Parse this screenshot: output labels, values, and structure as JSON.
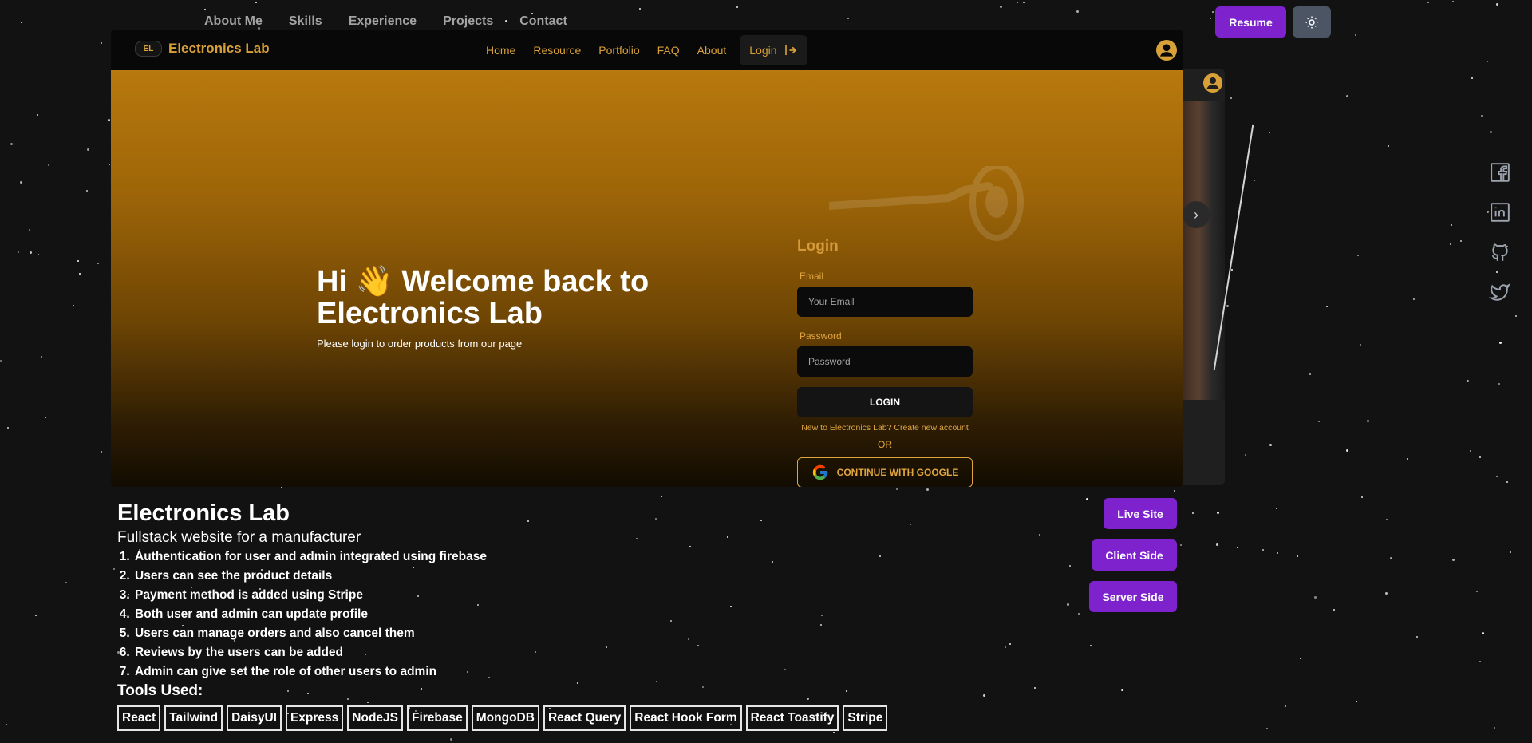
{
  "topnav": [
    "About Me",
    "Skills",
    "Experience",
    "Projects",
    "Contact"
  ],
  "buttons": {
    "resume": "Resume"
  },
  "card": {
    "logo_text": "EL",
    "brand": "Electronics Lab",
    "menu": [
      "Home",
      "Resource",
      "Portfolio",
      "FAQ",
      "About"
    ],
    "login_tab": "Login",
    "hero_title_1": "Hi 👋 Welcome back to",
    "hero_title_2": "Electronics Lab",
    "hero_sub": "Please login to order products from our page",
    "login": {
      "title": "Login",
      "email_label": "Email",
      "email_placeholder": "Your Email",
      "password_label": "Password",
      "password_placeholder": "Password",
      "button": "LOGIN",
      "new_account": "New to Electronics Lab? Create new account",
      "or": "OR",
      "google": "CONTINUE WITH GOOGLE"
    }
  },
  "carousel_next": "›",
  "project": {
    "title": "Electronics Lab",
    "subtitle": "Fullstack website for a manufacturer",
    "features": [
      "Authentication for user and admin integrated using firebase",
      "Users can see the product details",
      "Payment method is added using Stripe",
      "Both user and admin can update profile",
      "Users can manage orders and also cancel them",
      "Reviews by the users can be added",
      "Admin can give set the role of other users to admin"
    ],
    "tools_heading": "Tools Used:",
    "tools": [
      "React",
      "Tailwind",
      "DaisyUI",
      "Express",
      "NodeJS",
      "Firebase",
      "MongoDB",
      "React Query",
      "React Hook Form",
      "React Toastify",
      "Stripe"
    ],
    "links": {
      "live": "Live Site",
      "client": "Client Side",
      "server": "Server Side"
    }
  },
  "socials": [
    "facebook-icon",
    "linkedin-icon",
    "github-icon",
    "twitter-icon"
  ],
  "colors": {
    "accent": "#7e22ce",
    "gold": "#d8a038",
    "background": "#121212"
  }
}
